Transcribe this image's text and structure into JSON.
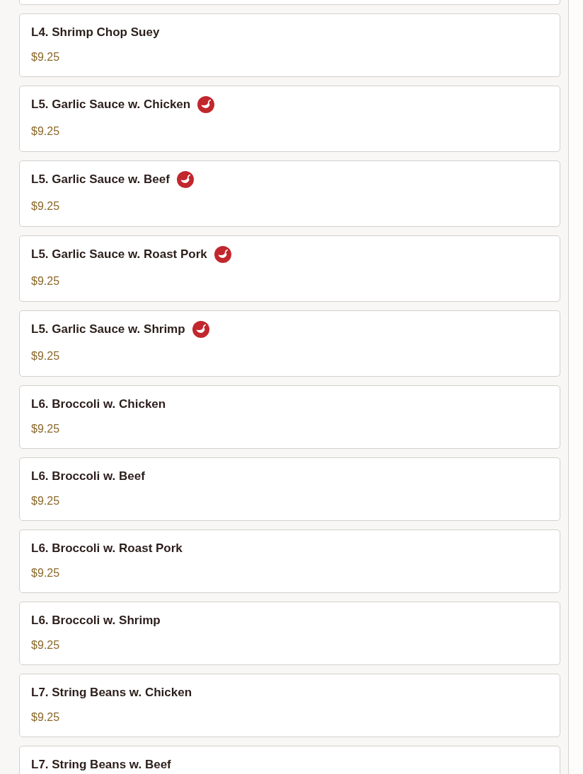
{
  "menu_items": [
    {
      "name": "L4. Shrimp Chop Suey",
      "price": "$9.25",
      "spicy": false
    },
    {
      "name": "L5. Garlic Sauce w. Chicken",
      "price": "$9.25",
      "spicy": true
    },
    {
      "name": "L5. Garlic Sauce w. Beef",
      "price": "$9.25",
      "spicy": true
    },
    {
      "name": "L5. Garlic Sauce w. Roast Pork",
      "price": "$9.25",
      "spicy": true
    },
    {
      "name": "L5. Garlic Sauce w. Shrimp",
      "price": "$9.25",
      "spicy": true
    },
    {
      "name": "L6. Broccoli w. Chicken",
      "price": "$9.25",
      "spicy": false
    },
    {
      "name": "L6. Broccoli w. Beef",
      "price": "$9.25",
      "spicy": false
    },
    {
      "name": "L6. Broccoli w. Roast Pork",
      "price": "$9.25",
      "spicy": false
    },
    {
      "name": "L6. Broccoli w. Shrimp",
      "price": "$9.25",
      "spicy": false
    },
    {
      "name": "L7. String Beans w. Chicken",
      "price": "$9.25",
      "spicy": false
    },
    {
      "name": "L7. String Beans w. Beef",
      "spicy": false
    }
  ]
}
